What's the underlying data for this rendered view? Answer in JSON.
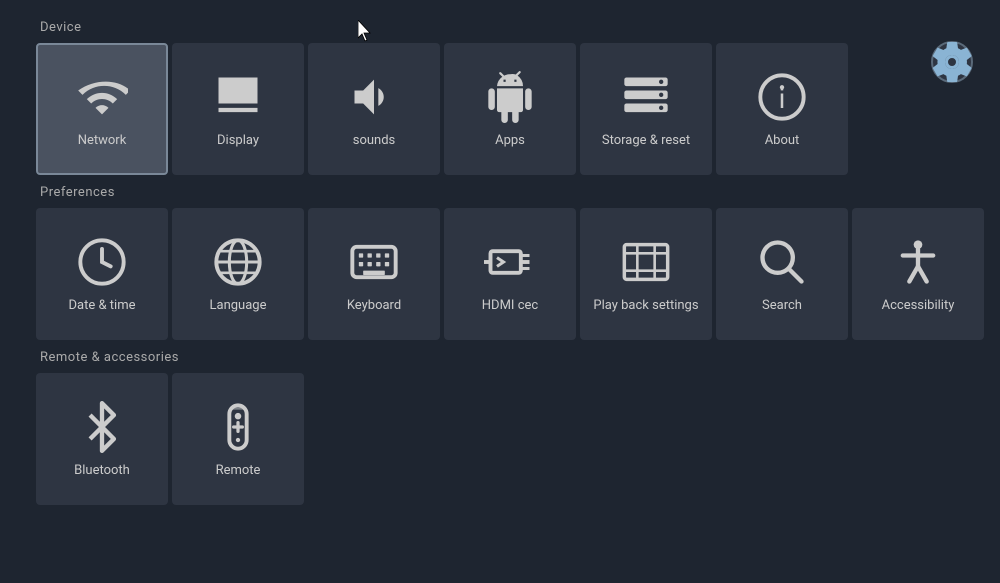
{
  "settings_icon": "⚙",
  "sections": {
    "device": {
      "label": "Device",
      "tiles": [
        {
          "id": "network",
          "label": "Network",
          "selected": true
        },
        {
          "id": "display",
          "label": "Display",
          "selected": false
        },
        {
          "id": "sounds",
          "label": "sounds",
          "selected": false
        },
        {
          "id": "apps",
          "label": "Apps",
          "selected": false
        },
        {
          "id": "storage-reset",
          "label": "Storage & reset",
          "selected": false
        },
        {
          "id": "about",
          "label": "About",
          "selected": false
        }
      ]
    },
    "preferences": {
      "label": "Preferences",
      "tiles": [
        {
          "id": "date-time",
          "label": "Date & time",
          "selected": false
        },
        {
          "id": "language",
          "label": "Language",
          "selected": false
        },
        {
          "id": "keyboard",
          "label": "Keyboard",
          "selected": false
        },
        {
          "id": "hdmi-cec",
          "label": "HDMI cec",
          "selected": false
        },
        {
          "id": "playback-settings",
          "label": "Play back settings",
          "selected": false
        },
        {
          "id": "search",
          "label": "Search",
          "selected": false
        },
        {
          "id": "accessibility",
          "label": "Accessibility",
          "selected": false
        }
      ]
    },
    "remote": {
      "label": "Remote & accessories",
      "tiles": [
        {
          "id": "bluetooth",
          "label": "Bluetooth",
          "selected": false
        },
        {
          "id": "remote",
          "label": "Remote",
          "selected": false
        }
      ]
    }
  }
}
